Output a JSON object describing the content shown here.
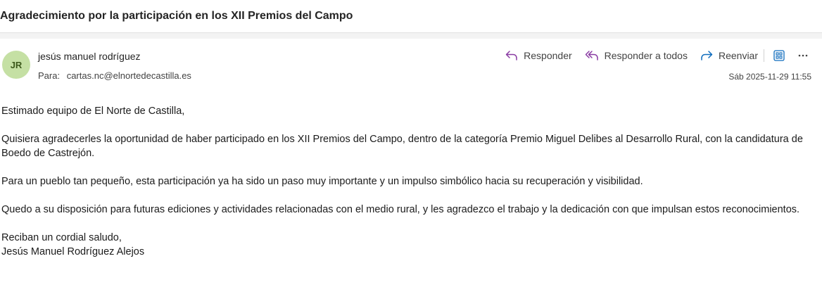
{
  "subject": "Agradecimiento por la participación en los XII Premios del Campo",
  "sender": {
    "initials": "JR",
    "name": "jesús manuel rodríguez",
    "avatar_color": "#c5e0a4"
  },
  "recipients": {
    "label": "Para:",
    "address": "cartas.nc@elnortedecastilla.es"
  },
  "actions": {
    "reply": "Responder",
    "reply_all": "Responder a todos",
    "forward": "Reenviar",
    "icons": [
      "reply-icon",
      "reply-all-icon",
      "forward-icon",
      "grid-view-icon",
      "more-options-icon"
    ]
  },
  "date": "Sáb 2025-11-29 11:55",
  "body": {
    "greeting": "Estimado equipo de El Norte de Castilla,",
    "paragraph1": "Quisiera agradecerles la oportunidad de haber participado en los XII Premios del Campo, dentro de la categoría Premio Miguel Delibes al Desarrollo Rural, con la candidatura de Boedo de Castrejón.",
    "paragraph2": "Para un pueblo tan pequeño, esta participación ya ha sido un paso muy importante y un impulso simbólico hacia su recuperación y visibilidad.",
    "paragraph3": "Quedo a su disposición para futuras ediciones y actividades relacionadas con el medio rural, y les agradezco el trabajo y la dedicación con que impulsan estos reconocimientos.",
    "closing": "Reciban un cordial saludo,",
    "signature": "Jesús Manuel Rodríguez Alejos"
  },
  "colors": {
    "accent": "#0f6cbd",
    "reply_all_accent": "#8a3ca3"
  }
}
